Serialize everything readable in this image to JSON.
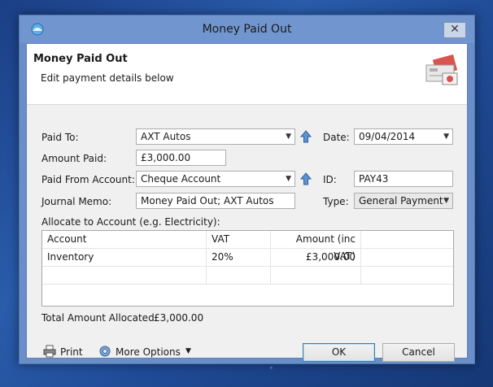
{
  "window": {
    "title": "Money Paid Out",
    "close_glyph": "✕"
  },
  "header": {
    "title": "Money Paid Out",
    "subtitle": "Edit payment details below",
    "icon": "cheque-payment-icon"
  },
  "form": {
    "paid_to": {
      "label": "Paid To:",
      "value": "AXT Autos"
    },
    "amount_paid": {
      "label": "Amount Paid:",
      "value": "£3,000.00"
    },
    "paid_from": {
      "label": "Paid From Account:",
      "value": "Cheque Account"
    },
    "memo": {
      "label": "Journal Memo:",
      "value": "Money Paid Out; AXT Autos"
    },
    "date": {
      "label": "Date:",
      "value": "09/04/2014"
    },
    "id": {
      "label": "ID:",
      "value": "PAY43"
    },
    "type": {
      "label": "Type:",
      "value": "General Payment"
    },
    "allocate_label": "Allocate to Account (e.g. Electricity):"
  },
  "grid": {
    "headers": [
      "Account",
      "VAT",
      "Amount (inc VAT)"
    ],
    "rows": [
      {
        "account": "Inventory",
        "vat": "20%",
        "amount": "£3,000.00"
      }
    ]
  },
  "totals": {
    "label": "Total Amount Allocated:",
    "value": "£3,000.00"
  },
  "footer": {
    "print_label": "Print",
    "more_label": "More Options",
    "ok_label": "OK",
    "cancel_label": "Cancel"
  }
}
